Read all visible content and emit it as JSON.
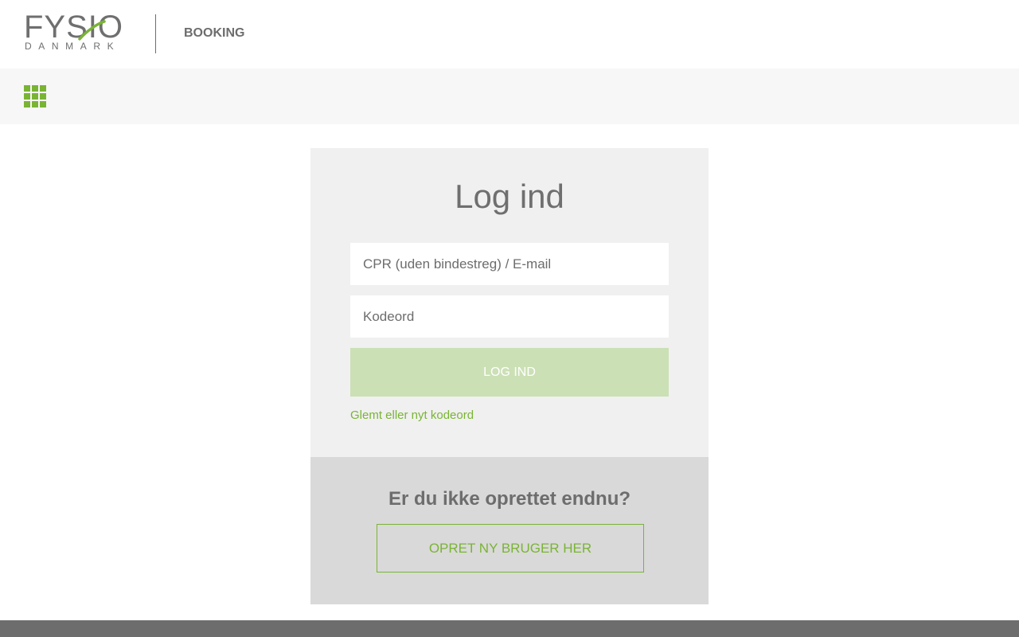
{
  "header": {
    "logo_text": "FYSIO",
    "logo_subtext": "DANMARK",
    "nav_booking": "BOOKING"
  },
  "login": {
    "title": "Log ind",
    "username_placeholder": "CPR (uden bindestreg) / E-mail",
    "password_placeholder": "Kodeord",
    "submit_label": "LOG IND",
    "forgot_link": "Glemt eller nyt kodeord"
  },
  "signup": {
    "heading": "Er du ikke oprettet endnu?",
    "button_label": "OPRET NY BRUGER HER"
  },
  "colors": {
    "accent": "#7ab434",
    "login_button_disabled": "#cbe0b5",
    "text": "#6d6d6d",
    "card_bg": "#f0f0f0",
    "signup_bg": "#d9d9d9",
    "footer_bg": "#6d6d6d"
  },
  "icons": {
    "menu_grid": "apps-grid-icon"
  }
}
